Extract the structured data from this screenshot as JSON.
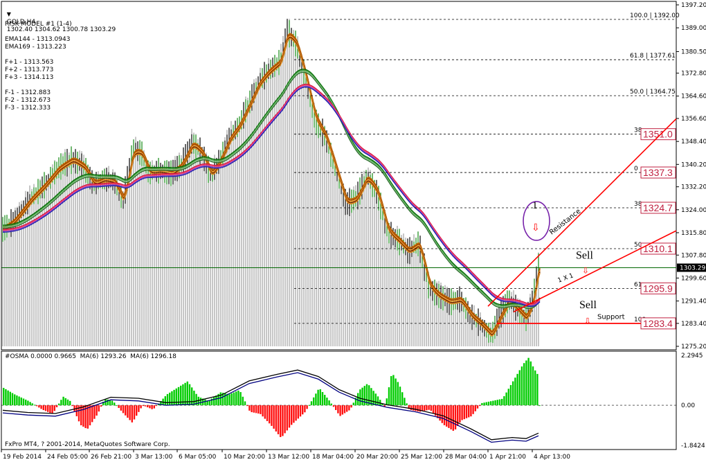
{
  "colors": {
    "bg": "#ffffff",
    "frame": "#000000",
    "grid": "#cfcfcf",
    "bar": "#8c8c8c",
    "bull": "#00aa00",
    "bear": "#ff0000",
    "fastRibbon": [
      "#c06a00",
      "#a34300",
      "#f0a030",
      "#7a2a00",
      "#d88a20"
    ],
    "midRibbon": [
      "#006600",
      "#3b9b3b",
      "#88c488",
      "#2f6f2f"
    ],
    "slowRibbon": [
      "#cc1144",
      "#ff4466",
      "#8844cc",
      "#2222aa"
    ],
    "annot": "#ff0000",
    "fibBox": "#c02040",
    "osmaLine1": "#000080",
    "osmaLine2": "#000000"
  },
  "header": {
    "symbol": "GOLD,H4",
    "ohlc": "1302.40 1304.62 1300.78 1303.29",
    "lines": [
      "RISK MODEL #1 (1-4)",
      "",
      "EMA144 - 1313.0943",
      "EMA169 - 1313.223",
      "",
      "F+1 - 1313.563",
      "F+2 - 1313.773",
      "F+3 - 1314.113",
      "",
      "F-1 - 1312.883",
      "F-2 - 1312.673",
      "F-3 - 1312.333"
    ]
  },
  "price_scale": {
    "labels": [
      "1397.20",
      "1389.00",
      "1380.50",
      "1372.80",
      "1364.60",
      "1356.60",
      "1348.40",
      "1340.20",
      "1332.20",
      "1324.00",
      "1315.80",
      "1307.80",
      "1299.60",
      "1291.40",
      "1283.40",
      "1275.20"
    ],
    "current": "1303.29"
  },
  "fib_levels": [
    {
      "label": "100.0 | 1392.00",
      "price": 1392.0
    },
    {
      "label": "61.8 | 1377.61",
      "price": 1377.61
    },
    {
      "label": "50.0 | 1364.75",
      "price": 1364.75
    },
    {
      "label": "38",
      "price": 1351.0
    },
    {
      "label": "0",
      "price": 1337.3
    },
    {
      "label": "38",
      "price": 1324.7
    },
    {
      "label": "50",
      "price": 1310.1
    },
    {
      "label": "61",
      "price": 1295.9
    },
    {
      "label": "100",
      "price": 1283.4
    }
  ],
  "level_boxes": [
    "1351.0",
    "1337.3",
    "1324.7",
    "1310.1",
    "1295.9",
    "1283.4"
  ],
  "annotations": {
    "sell1": "Sell",
    "sell2": "Sell",
    "support": "Support",
    "resistance": "Resistance",
    "one": "1",
    "ratio": "1 X 1"
  },
  "osma": {
    "header": "#OSMA 0.0000 0.9665  MA(6) 1293.26  MA(6) 1296.18",
    "scale": [
      "2.2945",
      "0.00",
      "-1.8424"
    ],
    "copyright": "FxPro MT4, ? 2001-2014, MetaQuotes Software Corp."
  },
  "time_axis": [
    "19 Feb 2014",
    "24 Feb 05:00",
    "26 Feb 21:00",
    "3 Mar 13:00",
    "6 Mar 05:00",
    "10 Mar 20:00",
    "13 Mar 12:00",
    "18 Mar 04:00",
    "20 Mar 20:00",
    "25 Mar 12:00",
    "28 Mar 04:00",
    "1 Apr 21:00",
    "4 Apr 13:00"
  ]
}
